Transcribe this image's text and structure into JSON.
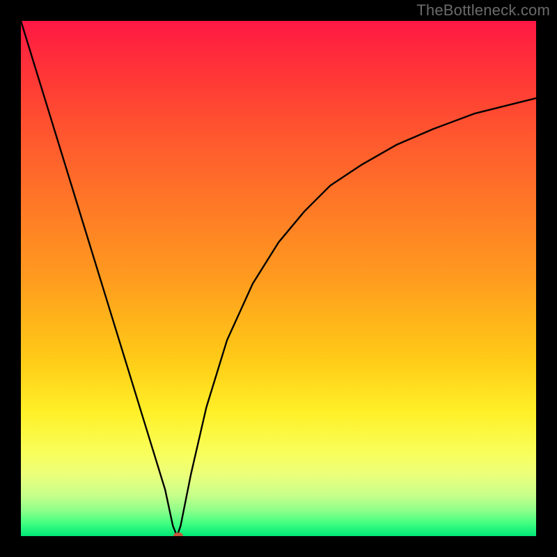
{
  "watermark": "TheBottleneck.com",
  "chart_data": {
    "type": "line",
    "title": "",
    "xlabel": "",
    "ylabel": "",
    "xlim": [
      0,
      100
    ],
    "ylim": [
      0,
      100
    ],
    "grid": false,
    "legend": false,
    "background": {
      "type": "vertical-gradient",
      "stops": [
        {
          "pos": 0,
          "color": "#ff1744"
        },
        {
          "pos": 50,
          "color": "#ff9b1f"
        },
        {
          "pos": 76,
          "color": "#fff028"
        },
        {
          "pos": 100,
          "color": "#00e676"
        }
      ]
    },
    "series": [
      {
        "name": "bottleneck-curve",
        "color": "#000000",
        "x": [
          0,
          4,
          8,
          12,
          16,
          20,
          24,
          28,
          29.5,
          30.3,
          31,
          33,
          36,
          40,
          45,
          50,
          55,
          60,
          66,
          73,
          80,
          88,
          94,
          100
        ],
        "y": [
          100,
          87,
          74,
          61,
          48,
          35,
          22,
          9,
          2,
          0,
          2,
          12,
          25,
          38,
          49,
          57,
          63,
          68,
          72,
          76,
          79,
          82,
          83.5,
          85
        ]
      }
    ],
    "marker": {
      "x": 30.5,
      "y": 0,
      "color": "#c4573b"
    }
  }
}
